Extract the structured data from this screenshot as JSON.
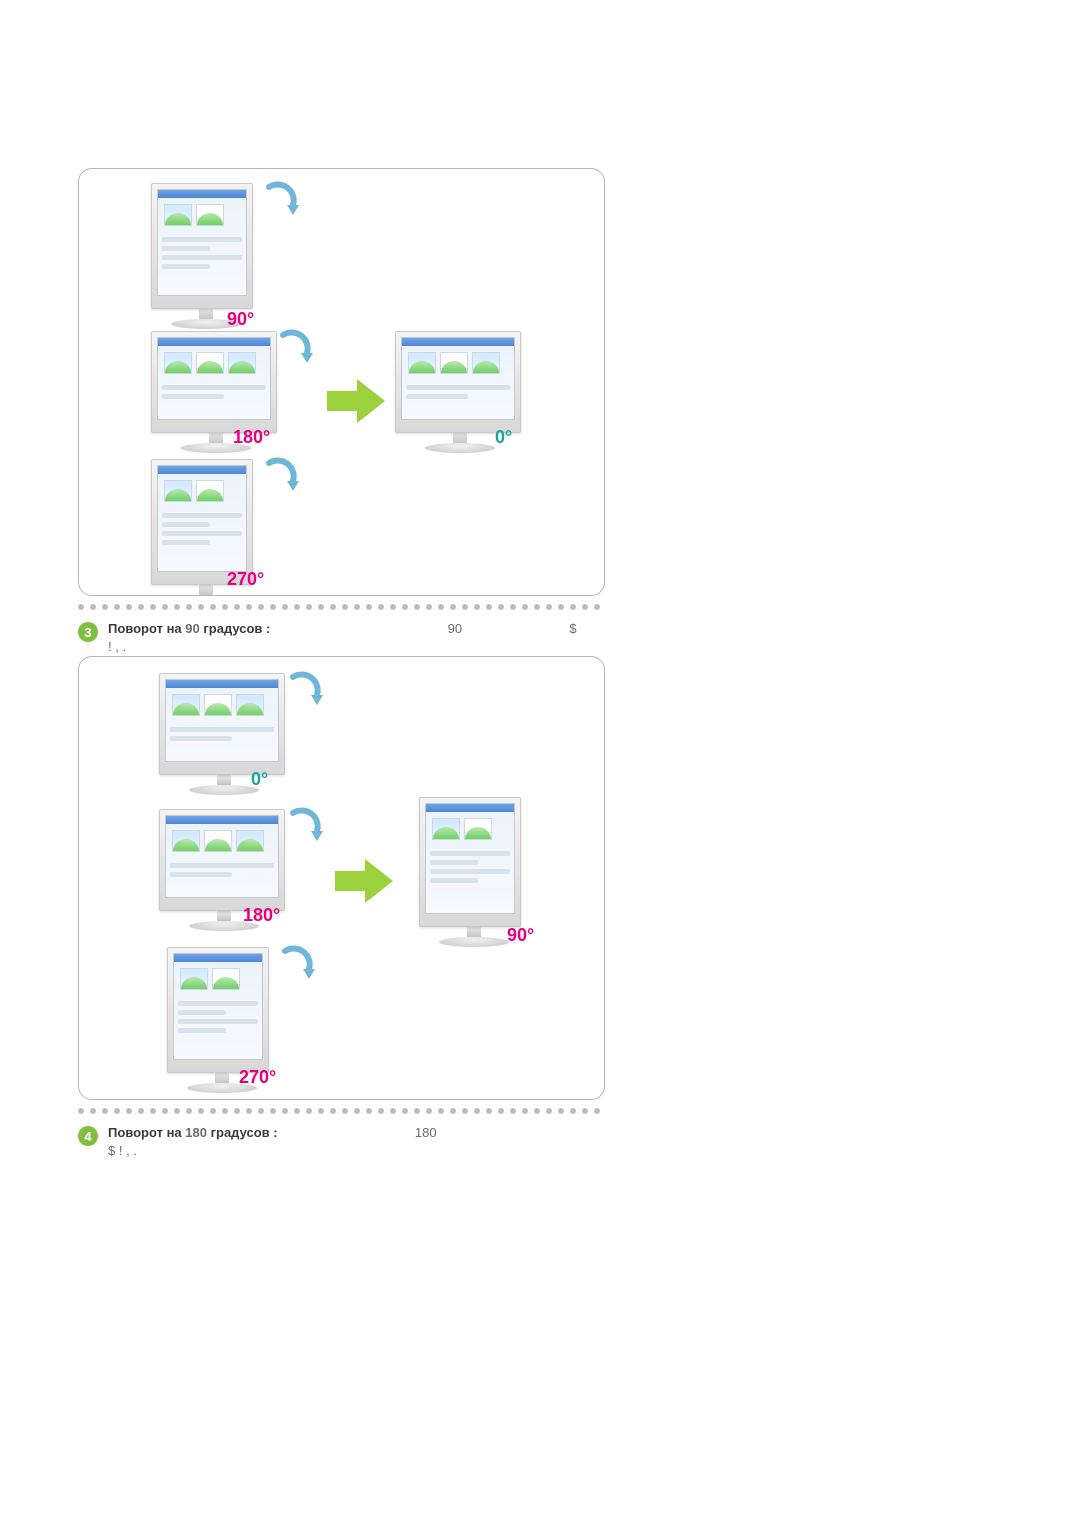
{
  "figures": {
    "fig1": {
      "labels": {
        "deg90": "90°",
        "deg180": "180°",
        "deg270": "270°",
        "deg0": "0°"
      }
    },
    "fig2": {
      "labels": {
        "deg0": "0°",
        "deg180": "180°",
        "deg270": "270°",
        "deg90": "90°"
      }
    }
  },
  "steps": {
    "s3": {
      "num": "3",
      "label_bold_prefix": "Поворот на ",
      "label_num": "90",
      "label_bold_suffix": " градусов :",
      "mid_number": "90",
      "right_symbol": "$",
      "tail": "!             ,             ."
    },
    "s4": {
      "num": "4",
      "label_bold_prefix": "Поворот на ",
      "label_num": "180",
      "label_bold_suffix": " градусов :",
      "mid_number": "180",
      "tail": "$              !             ,             ."
    }
  }
}
